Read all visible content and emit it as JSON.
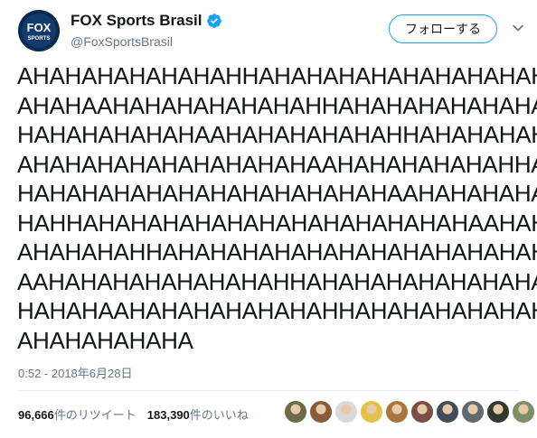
{
  "account": {
    "display_name": "FOX Sports Brasil",
    "handle": "@FoxSportsBrasil",
    "avatar_logo_top": "FOX",
    "avatar_logo_bottom": "SPORTS",
    "verified_icon": "verified-badge-icon"
  },
  "actions": {
    "follow_label": "フォローする",
    "menu_icon": "chevron-down-icon"
  },
  "tweet": {
    "lines": [
      "AHAHAHAHAHAHAHHAHAHAHAHAHAHAHAHAH",
      "AHAHAAHAHAHAHAHAHAHHAHAHAHAHAHAHA",
      "HAHAHAHAHAHAAHAHAHAHAHAHHAHAHAHAH",
      "AHAHAHAHAHAHAHAHAHAAHAHAHAHAHAHHA",
      "HAHAHAHAHAHAHAHAHAHAHAHAAHAHAHAHA",
      "HAHHAHAHAHAHAHAHAHAHAHAHAHAHAAHAH",
      "AHAHAHAHHAHAHAHAHAHAHAHAHAHAHAHAH",
      "AAHAHAHAHAHAHAHAHHAHAHAHAHAHAHAHA",
      "HAHAHAAHAHAHAHAHAHAHHAHAHAHAHAHAH",
      "AHAHAHAHAHA"
    ],
    "timestamp": "0:52 - 2018年6月28日"
  },
  "stats": {
    "retweets_count": "96,666",
    "retweets_label": "件のリツイート",
    "likes_count": "183,390",
    "likes_label": "件のいいね"
  },
  "likers": [
    {
      "color": "#6b6b4a"
    },
    {
      "color": "#8a5a3c"
    },
    {
      "color": "#d9d9d9"
    },
    {
      "color": "#e3c04a"
    },
    {
      "color": "#a8763e"
    },
    {
      "color": "#7a4f46"
    },
    {
      "color": "#3f4c5a"
    },
    {
      "color": "#5c6b72"
    },
    {
      "color": "#2e3a2c"
    },
    {
      "color": "#7d8f6a"
    }
  ]
}
